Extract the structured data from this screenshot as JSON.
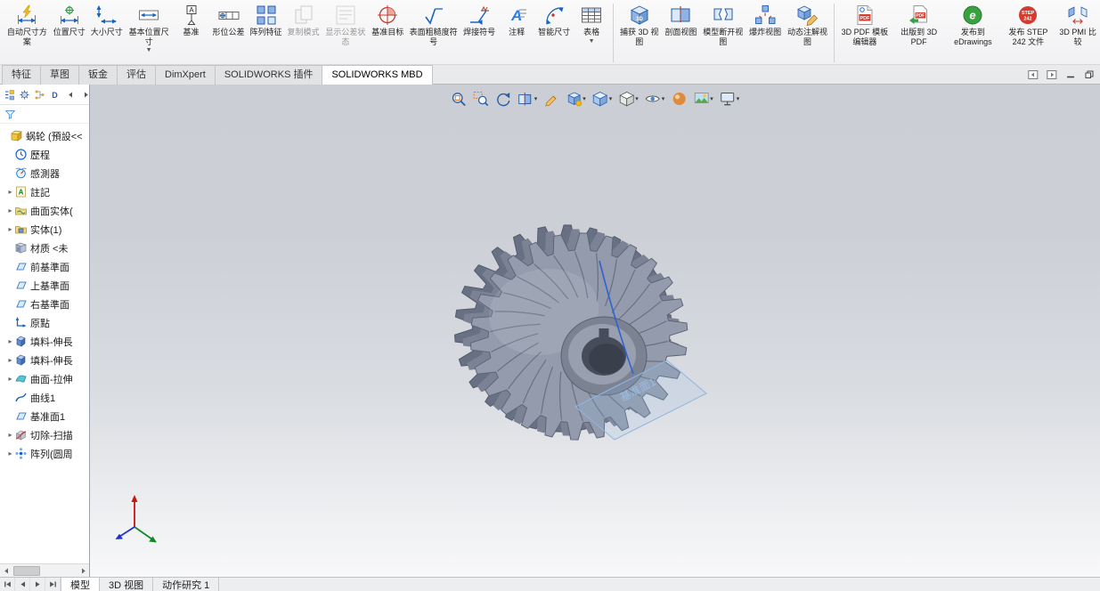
{
  "ribbon": {
    "groups": [
      {
        "buttons": [
          {
            "name": "auto-dimension-scheme",
            "icon": "dim-auto",
            "label": "自动尺寸方案"
          },
          {
            "name": "location-dimension",
            "icon": "dim-loc",
            "label": "位置尺寸"
          },
          {
            "name": "size-dimension",
            "icon": "dim-size",
            "label": "大小尺寸"
          },
          {
            "name": "basic-location-dimension",
            "icon": "dim-basic",
            "label": "基本位置尺寸",
            "dropdown": true
          },
          {
            "name": "datum",
            "icon": "datum",
            "label": "基准"
          },
          {
            "name": "geometric-tolerance",
            "icon": "gtol",
            "label": "形位公差"
          },
          {
            "name": "pattern-feature",
            "icon": "pattern",
            "label": "阵列特征"
          },
          {
            "name": "copy-scheme",
            "icon": "copy",
            "label": "复制模式",
            "disabled": true
          },
          {
            "name": "show-tolerance-status",
            "icon": "tolstatus",
            "label": "显示公差状态",
            "disabled": true
          },
          {
            "name": "datum-target",
            "icon": "datumtarget",
            "label": "基准目标"
          },
          {
            "name": "surface-finish-symbol",
            "icon": "surface",
            "label": "表面粗糙度符号"
          },
          {
            "name": "weld-symbol",
            "icon": "weld",
            "label": "焊接符号"
          },
          {
            "name": "note",
            "icon": "note",
            "label": "注释"
          },
          {
            "name": "smart-dimension",
            "icon": "smartdim",
            "label": "智能尺寸"
          },
          {
            "name": "tables",
            "icon": "table",
            "label": "表格",
            "dropdown": true
          }
        ]
      },
      {
        "buttons": [
          {
            "name": "capture-3d-view",
            "icon": "capture3d",
            "label": "捕获 3D 视图"
          },
          {
            "name": "section-view",
            "icon": "sectionview",
            "label": "剖面视图"
          },
          {
            "name": "model-break-view",
            "icon": "breakview",
            "label": "模型断开视图"
          },
          {
            "name": "exploded-view",
            "icon": "explode",
            "label": "爆炸视图"
          },
          {
            "name": "dynamic-annotation-views",
            "icon": "dynannot",
            "label": "动态注解视图"
          }
        ]
      },
      {
        "buttons": [
          {
            "name": "3d-pdf-template-editor",
            "icon": "pdftemplate",
            "label": "3D PDF 模板编辑器"
          },
          {
            "name": "publish-to-3d-pdf",
            "icon": "pdfpublish",
            "label": "出版到 3D PDF"
          },
          {
            "name": "publish-to-edrawings",
            "icon": "edrawings",
            "label": "发布到 eDrawings"
          },
          {
            "name": "publish-step-242",
            "icon": "step242",
            "label": "发布 STEP 242 文件"
          },
          {
            "name": "3d-pmi-compare",
            "icon": "pmicompare",
            "label": "3D PMI 比较"
          }
        ]
      }
    ]
  },
  "command_tabs": [
    {
      "name": "features",
      "label": "特征"
    },
    {
      "name": "sketch",
      "label": "草图"
    },
    {
      "name": "sheet-metal",
      "label": "钣金"
    },
    {
      "name": "evaluate",
      "label": "评估"
    },
    {
      "name": "dimxpert",
      "label": "DimXpert"
    },
    {
      "name": "solidworks-addins",
      "label": "SOLIDWORKS 插件"
    },
    {
      "name": "solidworks-mbd",
      "label": "SOLIDWORKS MBD",
      "active": true
    }
  ],
  "feature_tree": {
    "root": {
      "label": "蜗轮 (預設<<",
      "icon": "part"
    },
    "items": [
      {
        "label": "歷程",
        "icon": "history"
      },
      {
        "label": "感測器",
        "icon": "sensors"
      },
      {
        "label": "註記",
        "icon": "annotations",
        "expand": true
      },
      {
        "label": "曲面实体(",
        "icon": "surfacebodies",
        "expand": true
      },
      {
        "label": "实体(1)",
        "icon": "solidbodies",
        "expand": true
      },
      {
        "label": "材质 <未",
        "icon": "material"
      },
      {
        "label": "前基準面",
        "icon": "plane"
      },
      {
        "label": "上基準面",
        "icon": "plane"
      },
      {
        "label": "右基準面",
        "icon": "plane"
      },
      {
        "label": "原點",
        "icon": "origin"
      },
      {
        "label": "填料-伸長",
        "icon": "extrude",
        "expand": true
      },
      {
        "label": "填料-伸長",
        "icon": "extrude",
        "expand": true
      },
      {
        "label": "曲面-拉伸",
        "icon": "surfext",
        "expand": true
      },
      {
        "label": "曲线1",
        "icon": "curve"
      },
      {
        "label": "基准面1",
        "icon": "plane"
      },
      {
        "label": "切除-扫描",
        "icon": "cutsweep",
        "expand": true
      },
      {
        "label": "阵列(圆周",
        "icon": "circpattern",
        "expand": true
      }
    ]
  },
  "headsup_tools": [
    {
      "name": "zoom-to-fit",
      "icon": "zoomfit"
    },
    {
      "name": "zoom-to-area",
      "icon": "zoomarea"
    },
    {
      "name": "previous-view",
      "icon": "prevview"
    },
    {
      "name": "section-view",
      "icon": "hsection",
      "dropdown": true
    },
    {
      "name": "dynamic-annotation-views",
      "icon": "hdynannot"
    },
    {
      "name": "capture-3d-view",
      "icon": "hcapture",
      "dropdown": true
    },
    {
      "name": "view-orientation",
      "icon": "vieworient",
      "dropdown": true
    },
    {
      "name": "display-style",
      "icon": "displaystyle",
      "dropdown": true
    },
    {
      "name": "hide-show-items",
      "icon": "hideshow",
      "dropdown": true
    },
    {
      "name": "edit-appearance",
      "icon": "editappearance"
    },
    {
      "name": "apply-scene",
      "icon": "applyscene",
      "dropdown": true
    },
    {
      "name": "view-settings",
      "icon": "viewsettings",
      "dropdown": true
    }
  ],
  "viewport": {
    "plane_label": "基准面1"
  },
  "bottom_tabs": [
    {
      "name": "model",
      "label": "模型",
      "active": true
    },
    {
      "name": "3d-views",
      "label": "3D 视图"
    },
    {
      "name": "motion-study-1",
      "label": "动作研究 1"
    }
  ]
}
